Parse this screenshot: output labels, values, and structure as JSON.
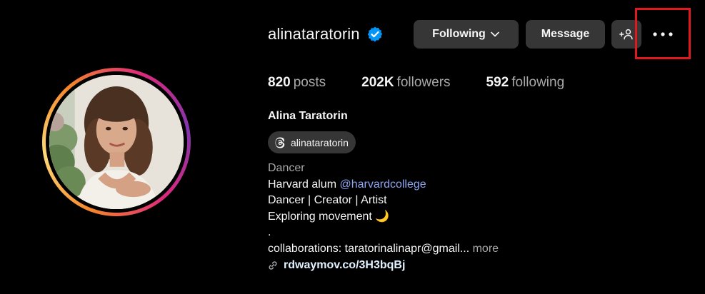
{
  "profile": {
    "username": "alinataratorin",
    "verified": true,
    "full_name": "Alina Taratorin",
    "threads_handle": "alinataratorin"
  },
  "actions": {
    "following_label": "Following",
    "message_label": "Message",
    "suggest_icon": "person-plus-icon",
    "more_icon": "more-options-icon"
  },
  "stats": {
    "posts_count": "820",
    "posts_label": "posts",
    "followers_count": "202K",
    "followers_label": "followers",
    "following_count": "592",
    "following_label": "following"
  },
  "bio": {
    "category": "Dancer",
    "line1_text": "Harvard alum ",
    "line1_mention": "@harvardcollege",
    "line2": "Dancer | Creator | Artist",
    "line3": "Exploring movement 🌙",
    "line4": ".",
    "line5": "collaborations: taratorinalinapr@gmail...",
    "more_label": " more",
    "link": "rdwaymov.co/3H3bqBj"
  },
  "colors": {
    "background": "#000000",
    "button": "#363636",
    "verified": "#0095f6",
    "highlight_box": "#e0191e",
    "mention": "#8da4f2"
  }
}
